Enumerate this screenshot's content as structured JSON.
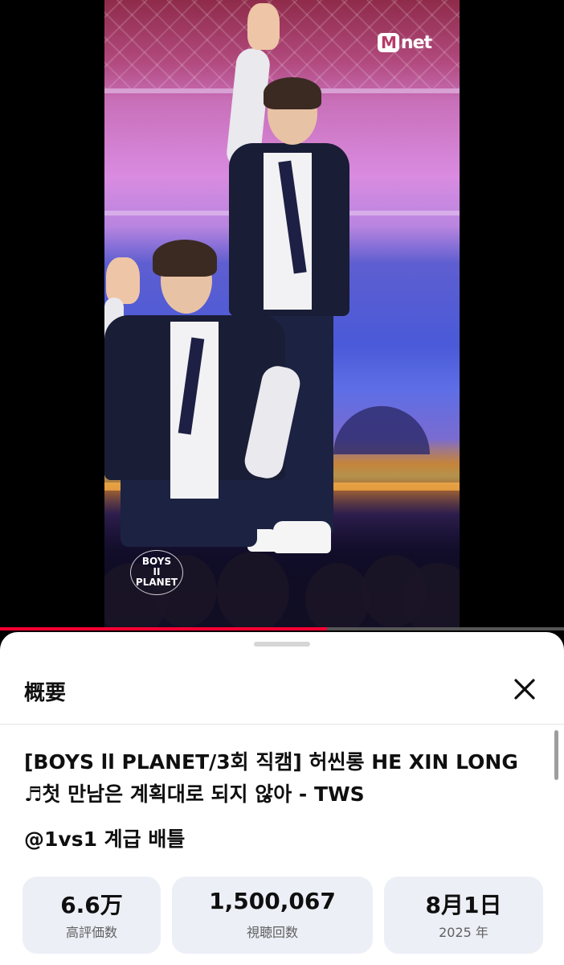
{
  "video": {
    "channel_logo_text": "Mnet",
    "overlay_logo_text": [
      "BOYS",
      "II",
      "PLANET"
    ],
    "progress_fraction": 0.58
  },
  "sheet": {
    "title": "概要",
    "close_icon": "close-icon",
    "video_title": "[BOYS ll PLANET/3회 직캠] 허씬롱 HE XIN LONG ♬첫 만남은 계획대로 되지 않아 - TWS",
    "channel_line": "@1vs1 계급 배틀",
    "stats": [
      {
        "value": "6.6万",
        "label": "高評価数"
      },
      {
        "value": "1,500,067",
        "label": "視聴回数"
      },
      {
        "value": "8月1日",
        "label": "2025 年"
      }
    ]
  },
  "colors": {
    "progress": "#ff0033",
    "stat_bg": "#eceff6",
    "sheet_bg": "#ffffff"
  }
}
